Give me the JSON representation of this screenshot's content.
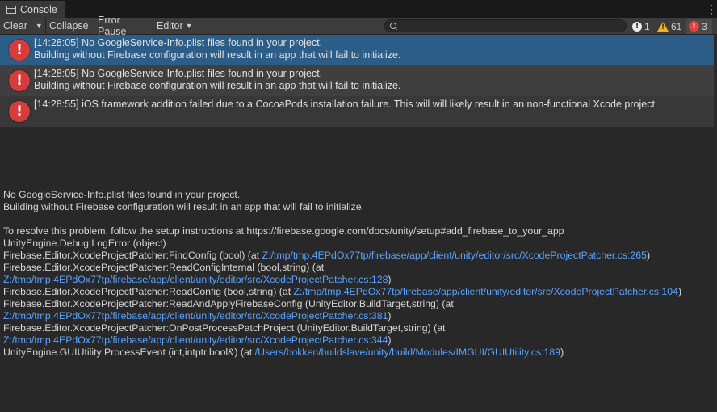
{
  "window": {
    "tab_label": "Console",
    "menu_glyph": "⋮"
  },
  "toolbar": {
    "clear_label": "Clear",
    "collapse_label": "Collapse",
    "error_pause_label": "Error Pause",
    "editor_label": "Editor",
    "search_value": "",
    "counts": {
      "info": "1",
      "warnings": "61",
      "errors": "3"
    }
  },
  "icons": {
    "info": "info-icon",
    "warning": "warning-icon",
    "error": "error-icon",
    "search": "search-icon",
    "console": "console-tab-icon"
  },
  "colors": {
    "selected_row": "#2c5d87",
    "error_red": "#d63c3c",
    "warning_yellow": "#f2b21a",
    "link_blue": "#5ba3ff"
  },
  "log_entries": [
    {
      "line1": "[14:28:05] No GoogleService-Info.plist files found in your project.",
      "line2": "Building without Firebase configuration will result in an app that will fail to initialize.",
      "selected": true
    },
    {
      "line1": "[14:28:05] No GoogleService-Info.plist files found in your project.",
      "line2": "Building without Firebase configuration will result in an app that will fail to initialize.",
      "selected": false
    },
    {
      "line1": "[14:28:55] iOS framework addition failed due to a CocoaPods installation failure. This will will likely result in an non-functional Xcode project.",
      "line2": "",
      "selected": false
    }
  ],
  "detail": {
    "message_line1": "No GoogleService-Info.plist files found in your project.",
    "message_line2": "Building without Firebase configuration will result in an app that will fail to initialize.",
    "resolve_line": "To resolve this problem, follow the setup instructions at https://firebase.google.com/docs/unity/setup#add_firebase_to_your_app",
    "stack": [
      {
        "text": "UnityEngine.Debug:LogError (object)",
        "link": "",
        "suffix": ""
      },
      {
        "text": "Firebase.Editor.XcodeProjectPatcher:FindConfig (bool) (at ",
        "link": "Z:/tmp/tmp.4EPdOx77tp/firebase/app/client/unity/editor/src/XcodeProjectPatcher.cs:265",
        "suffix": ")"
      },
      {
        "text": "Firebase.Editor.XcodeProjectPatcher:ReadConfigInternal (bool,string) (at",
        "link": "",
        "suffix": ""
      },
      {
        "text": "",
        "link": "Z:/tmp/tmp.4EPdOx77tp/firebase/app/client/unity/editor/src/XcodeProjectPatcher.cs:128",
        "suffix": ")"
      },
      {
        "text": "Firebase.Editor.XcodeProjectPatcher:ReadConfig (bool,string) (at ",
        "link": "Z:/tmp/tmp.4EPdOx77tp/firebase/app/client/unity/editor/src/XcodeProjectPatcher.cs:104",
        "suffix": ")"
      },
      {
        "text": "Firebase.Editor.XcodeProjectPatcher:ReadAndApplyFirebaseConfig (UnityEditor.BuildTarget,string) (at",
        "link": "",
        "suffix": ""
      },
      {
        "text": "",
        "link": "Z:/tmp/tmp.4EPdOx77tp/firebase/app/client/unity/editor/src/XcodeProjectPatcher.cs:381",
        "suffix": ")"
      },
      {
        "text": "Firebase.Editor.XcodeProjectPatcher:OnPostProcessPatchProject (UnityEditor.BuildTarget,string) (at",
        "link": "",
        "suffix": ""
      },
      {
        "text": "",
        "link": "Z:/tmp/tmp.4EPdOx77tp/firebase/app/client/unity/editor/src/XcodeProjectPatcher.cs:344",
        "suffix": ")"
      },
      {
        "text": "UnityEngine.GUIUtility:ProcessEvent (int,intptr,bool&) (at ",
        "link": "/Users/bokken/buildslave/unity/build/Modules/IMGUI/GUIUtility.cs:189",
        "suffix": ")"
      }
    ]
  }
}
